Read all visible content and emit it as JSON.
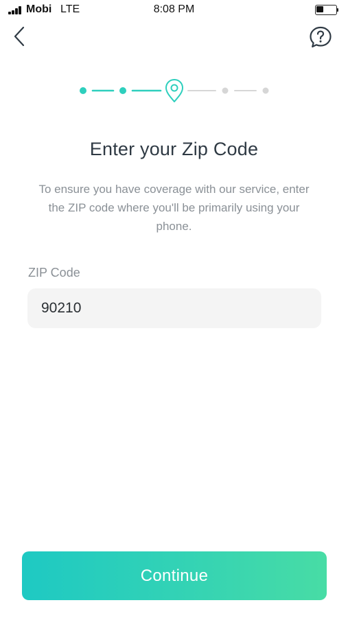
{
  "status_bar": {
    "carrier": "Mobi",
    "network": "LTE",
    "time": "8:08 PM",
    "battery_level": 0.4
  },
  "nav": {
    "back_icon": "chevron-left-icon",
    "help_icon": "question-bubble-icon"
  },
  "stepper": {
    "total_steps": 5,
    "current_step": 3,
    "current_icon": "location-pin-icon",
    "active_color": "#2ecfbd",
    "inactive_color": "#d6d6d6"
  },
  "page": {
    "title": "Enter your Zip Code",
    "subtitle": "To ensure you have coverage with our service, enter the ZIP code where you'll be primarily using your phone."
  },
  "zip_field": {
    "label": "ZIP Code",
    "value": "90210"
  },
  "continue_button": {
    "label": "Continue"
  },
  "colors": {
    "accent": "#2ecfbd",
    "title_text": "#2f3a44",
    "muted_text": "#8a9096",
    "input_background": "#f4f4f4"
  }
}
